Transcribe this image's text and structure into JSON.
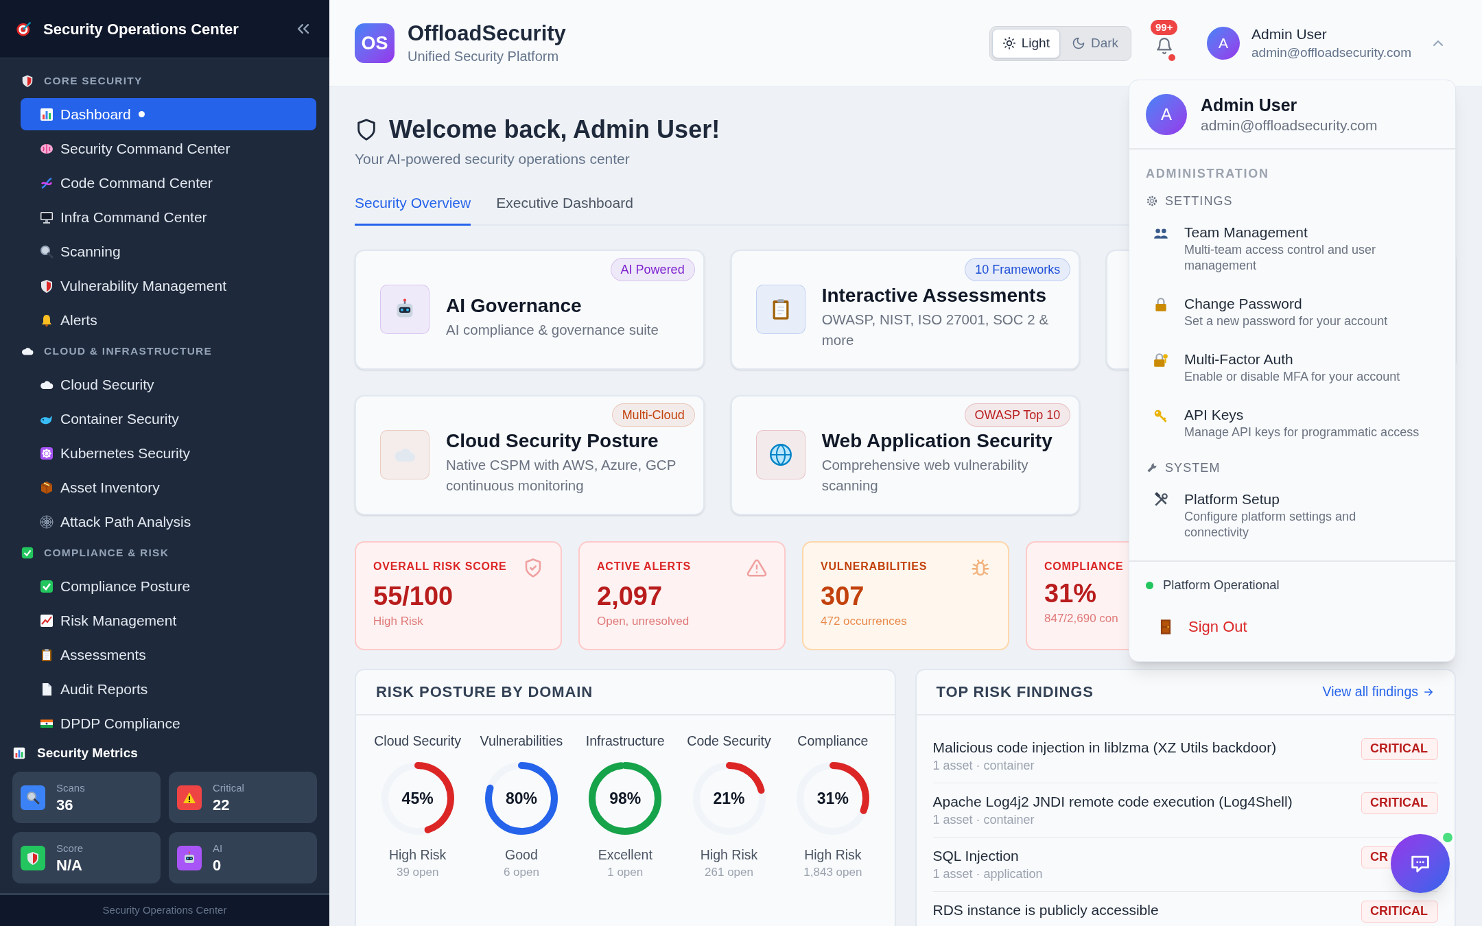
{
  "sidebar": {
    "title": "Security Operations Center",
    "sections": [
      {
        "title": "CORE SECURITY",
        "items": [
          {
            "label": "Dashboard",
            "selected": true
          },
          {
            "label": "Security Command Center",
            "selected": false
          },
          {
            "label": "Code Command Center",
            "selected": false
          },
          {
            "label": "Infra Command Center",
            "selected": false
          },
          {
            "label": "Scanning",
            "selected": false
          },
          {
            "label": "Vulnerability Management",
            "selected": false
          },
          {
            "label": "Alerts",
            "selected": false
          }
        ]
      },
      {
        "title": "CLOUD & INFRASTRUCTURE",
        "items": [
          {
            "label": "Cloud Security",
            "selected": false
          },
          {
            "label": "Container Security",
            "selected": false
          },
          {
            "label": "Kubernetes Security",
            "selected": false
          },
          {
            "label": "Asset Inventory",
            "selected": false
          },
          {
            "label": "Attack Path Analysis",
            "selected": false
          }
        ]
      },
      {
        "title": "COMPLIANCE & RISK",
        "items": [
          {
            "label": "Compliance Posture",
            "selected": false
          },
          {
            "label": "Risk Management",
            "selected": false
          },
          {
            "label": "Assessments",
            "selected": false
          },
          {
            "label": "Audit Reports",
            "selected": false
          },
          {
            "label": "DPDP Compliance",
            "selected": false
          }
        ]
      }
    ],
    "metrics_title": "Security Metrics",
    "metrics": [
      {
        "label": "Scans",
        "value": "36",
        "color": "#3b82f6"
      },
      {
        "label": "Critical",
        "value": "22",
        "color": "#ef4444"
      },
      {
        "label": "Score",
        "value": "N/A",
        "color": "#22c55e"
      },
      {
        "label": "AI",
        "value": "0",
        "color": "#a855f7"
      }
    ],
    "footer": "Security Operations Center"
  },
  "header": {
    "logo": "OS",
    "brand": "OffloadSecurity",
    "tagline": "Unified Security Platform",
    "themes": [
      {
        "label": "Light",
        "selected": true
      },
      {
        "label": "Dark",
        "selected": false
      }
    ],
    "notifications": "99+",
    "user": {
      "initial": "A",
      "name": "Admin User",
      "email": "admin@offloadsecurity.com",
      "expanded": true
    }
  },
  "user_menu": {
    "initial": "A",
    "name": "Admin User",
    "email": "admin@offloadsecurity.com",
    "heading": "ADMINISTRATION",
    "groups": [
      {
        "title": "SETTINGS",
        "items": [
          {
            "title": "Team Management",
            "description": "Multi-team access control and user management"
          },
          {
            "title": "Change Password",
            "description": "Set a new password for your account"
          },
          {
            "title": "Multi-Factor Auth",
            "description": "Enable or disable MFA for your account"
          },
          {
            "title": "API Keys",
            "description": "Manage API keys for programmatic access"
          }
        ]
      },
      {
        "title": "SYSTEM",
        "items": [
          {
            "title": "Platform Setup",
            "description": "Configure platform settings and connectivity"
          }
        ]
      }
    ],
    "status": "Platform Operational",
    "sign_out": "Sign Out"
  },
  "welcome": {
    "title": "Welcome back, Admin User!",
    "subtitle": "Your AI-powered security operations center"
  },
  "tabs": [
    {
      "label": "Security Overview",
      "selected": true
    },
    {
      "label": "Executive Dashboard",
      "selected": false
    }
  ],
  "feature_cards": [
    {
      "title": "AI Governance",
      "description": "AI compliance & governance suite",
      "badge": "AI Powered",
      "color": "#7e22ce"
    },
    {
      "title": "Interactive Assessments",
      "description": "OWASP, NIST, ISO 27001, SOC 2 & more",
      "badge": "10 Frameworks",
      "color": "#1d4ed8"
    },
    {
      "title": "Cloud Security Posture",
      "description": "Native CSPM with AWS, Azure, GCP continuous monitoring",
      "badge": "Multi-Cloud",
      "color": "#c2410c"
    },
    {
      "title": "Web Application Security",
      "description": "Comprehensive web vulnerability scanning",
      "badge": "OWASP Top 10",
      "color": "#b91c1c"
    }
  ],
  "metric_cards": [
    {
      "title": "OVERALL RISK SCORE",
      "value": "55/100",
      "subtitle": "High Risk",
      "kind": "danger"
    },
    {
      "title": "ACTIVE ALERTS",
      "value": "2,097",
      "subtitle": "Open, unresolved",
      "kind": "danger"
    },
    {
      "title": "VULNERABILITIES",
      "value": "307",
      "subtitle": "472 occurrences",
      "kind": "warning"
    },
    {
      "title": "COMPLIANCE",
      "value": "31%",
      "subtitle": "847/2,690 con",
      "kind": "danger"
    }
  ],
  "risk_posture": {
    "title": "RISK POSTURE BY DOMAIN",
    "domains": [
      {
        "name": "Cloud Security",
        "percent": "45%",
        "level": 0.45,
        "color": "#dc2626",
        "status": "High Risk",
        "open": "39 open"
      },
      {
        "name": "Vulnerabilities",
        "percent": "80%",
        "level": 0.8,
        "color": "#2563eb",
        "status": "Good",
        "open": "6 open"
      },
      {
        "name": "Infrastructure",
        "percent": "98%",
        "level": 0.98,
        "color": "#16a34a",
        "status": "Excellent",
        "open": "1 open"
      },
      {
        "name": "Code Security",
        "percent": "21%",
        "level": 0.21,
        "color": "#dc2626",
        "status": "High Risk",
        "open": "261 open"
      },
      {
        "name": "Compliance",
        "percent": "31%",
        "level": 0.31,
        "color": "#dc2626",
        "status": "High Risk",
        "open": "1,843 open"
      }
    ]
  },
  "findings": {
    "title": "TOP RISK FINDINGS",
    "link": "View all findings",
    "items": [
      {
        "title": "Malicious code injection in liblzma (XZ Utils backdoor)",
        "meta": "1 asset · container",
        "severity": "CRITICAL"
      },
      {
        "title": "Apache Log4j2 JNDI remote code execution (Log4Shell)",
        "meta": "1 asset · container",
        "severity": "CRITICAL"
      },
      {
        "title": "SQL Injection",
        "meta": "1 asset · application",
        "severity": "CR"
      },
      {
        "title": "RDS instance is publicly accessible",
        "severity": "CRITICAL"
      }
    ]
  }
}
